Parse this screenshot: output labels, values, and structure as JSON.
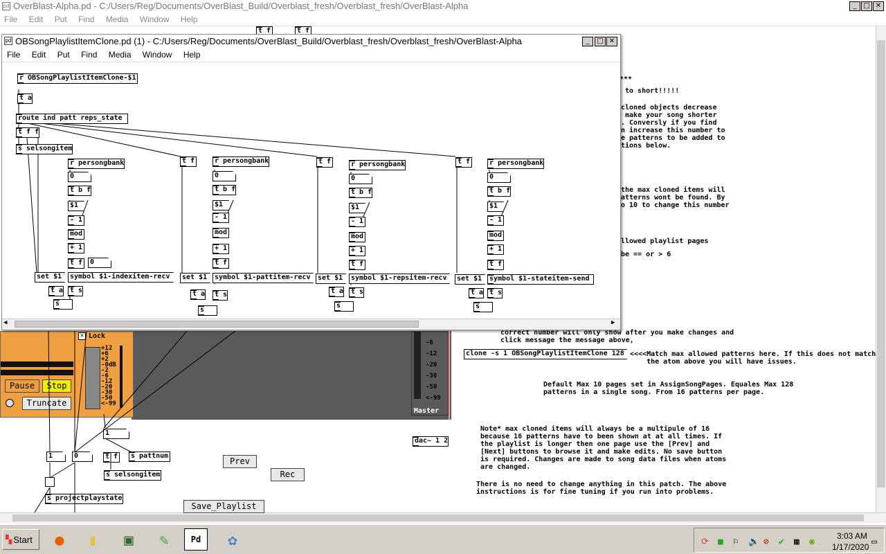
{
  "main_window": {
    "title": "OverBlast-Alpha.pd  - C:/Users/Reg/Documents/OverBlast_Build/Overblast_fresh/Overblast_fresh/OverBlast-Alpha",
    "menu": [
      "File",
      "Edit",
      "Put",
      "Find",
      "Media",
      "Window",
      "Help"
    ]
  },
  "child_window": {
    "title": "OBSongPlaylistItemClone.pd  (1) - C:/Users/Reg/Documents/OverBlast_Build/Overblast_fresh/Overblast_fresh/OverBlast-Alpha",
    "menu": [
      "File",
      "Edit",
      "Put",
      "Find",
      "Media",
      "Window",
      "Help"
    ],
    "objects": {
      "recv": "r OBSongPlaylistItemClone-$1",
      "ta_top": "t a",
      "route": "route ind patt reps_state",
      "tff": "t f f",
      "selsongitem": "s selsongitem",
      "tf": "t f",
      "persongbank": "r persongbank",
      "zero": "0",
      "tbf": "t b f",
      "dollar1": "$1",
      "minus1": "- 1",
      "mod": "mod",
      "plus1": "+ 1",
      "set1": "set $1",
      "ta": "t a",
      "ts": "t s",
      "s": "s",
      "sym1": "symbol $1-indexitem-recv",
      "sym2": "symbol $1-pattitem-recv",
      "sym3": "symbol $1-repsitem-recv",
      "sym4": "symbol $1-stateitem-send"
    }
  },
  "right_panel": {
    "stars": "***",
    "short": "to short!!!!!",
    "para1": "cloned objects decrease\n make your song shorter\n. Conversly if you find\nn increase this number to\ne patterns to be added to\ntions below.",
    "para2": "the max cloned items will\natterns wont be found. By\no 10 to change this number",
    "para3": "llowed playlist pages",
    "para4": "be == or > 6",
    "para5": " number of patterns allowed in\na set the max number of pages\nhange XXX to match to this\n clone -s 1\nou must do this manually. The\n correct number will only show after you make changes and\n click message the message above,",
    "clone_msg": "clone -s 1 OBSongPlaylistItemClone 128",
    "match_note": "<<<<Match max allowed patterns here. If this does not match\n    the atom above you will have issues.",
    "default_note": "Default Max 10 pages set in AssignSongPages. Equales Max 128\npatterns in a single song. From 16 patterns per page.",
    "note_star": "Note* max cloned items will always be a multipule of 16\nbecause 16 patterns have to been shown at at all times. If\nthe playlist is longer then one page use the [Prev] and\n[Next] buttons to browse it and make edits. No save button\nis required. Changes are made to song data files when atoms\nare changed.",
    "no_need": "There is no need to change anything in this patch. The above\ninstructions is for fine tuning if you run into problems."
  },
  "mixer": {
    "lock": "Lock",
    "pause": "Pause",
    "stop": "Stop",
    "truncate": "Truncate",
    "scale_left": [
      "+12",
      "+6",
      "+2",
      "-0dB",
      "-2",
      "-6",
      "-12",
      "-20",
      "-30",
      "-50",
      "<-99"
    ],
    "scale_right": [
      "-6",
      "-12",
      "-20",
      "-30",
      "-50",
      "<-99"
    ],
    "master": "Master",
    "dac": "dac~ 1 2"
  },
  "main_objects": {
    "one": "1",
    "zero": "0",
    "tf": "t f",
    "pattnum": "s pattnum",
    "selsongitem": "s selsongitem",
    "projectplaystate": "s projectplaystate",
    "prev": "Prev",
    "rec": "Rec",
    "save_playlist": "Save_Playlist",
    "top_tf1": "t f",
    "top_tf2": "t f"
  },
  "taskbar": {
    "start": "Start",
    "time": "3:03 AM",
    "date": "1/17/2020",
    "apps": [
      "firefox-icon",
      "folder-icon",
      "monitor-icon",
      "notepad-icon",
      "pd-icon",
      "paint-icon"
    ]
  },
  "colors": {
    "mixer_orange": "#f0a040",
    "stop_yellow": "#f0f000",
    "taskbar": "#d4d0c8"
  }
}
